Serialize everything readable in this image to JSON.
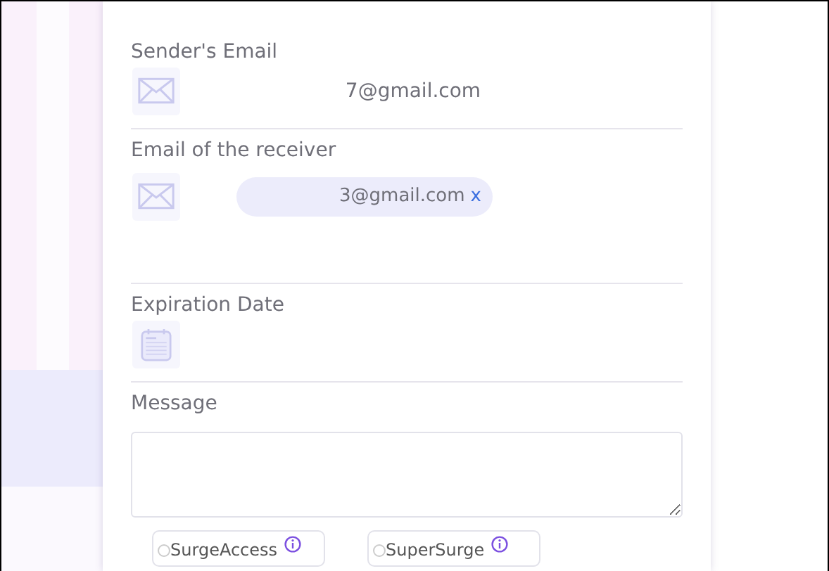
{
  "form": {
    "fields": [
      {
        "kind": "email",
        "label": "Sender's Email",
        "value": "7@gmail.com"
      },
      {
        "kind": "chips",
        "label": "Email of the receiver",
        "chips": [
          "3@gmail.com"
        ],
        "remove": "x"
      },
      {
        "kind": "date",
        "label": "Expiration Date"
      },
      {
        "kind": "textarea",
        "label": "Message"
      }
    ],
    "options": [
      {
        "label": "SurgeAccess",
        "selected": false
      },
      {
        "label": "SuperSurge",
        "selected": false
      }
    ]
  }
}
